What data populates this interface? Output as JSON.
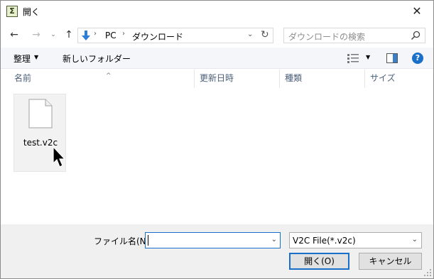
{
  "window": {
    "title": "開く",
    "app_icon": "sigma-app-icon",
    "close_label": "✕"
  },
  "nav": {
    "back_glyph": "←",
    "forward_glyph": "→",
    "recent_glyph": "⌄",
    "up_glyph": "↑",
    "address": {
      "sep1": "›",
      "pc": "PC",
      "sep2": "›",
      "folder": "ダウンロード",
      "dropdown_glyph": "⌄",
      "refresh_glyph": "↻"
    },
    "search": {
      "placeholder": "ダウンロードの検索",
      "icon": "search-icon"
    }
  },
  "toolbar": {
    "organize_label": "整理",
    "organize_caret": "▼",
    "new_folder_label": "新しいフォルダー",
    "views_caret": "▼",
    "help_label": "?"
  },
  "columns": {
    "sort_arrow": "^",
    "name": "名前",
    "date": "更新日時",
    "type": "種類",
    "size": "サイズ"
  },
  "files": [
    {
      "name": "test.v2c",
      "icon": "document-icon"
    }
  ],
  "bottom": {
    "filename_label": "ファイル名(N):",
    "filename_value": "",
    "filename_dd": "⌄",
    "filetype_value": "V2C File(*.v2c)",
    "filetype_dd": "⌄",
    "open_button": "開く(O)",
    "cancel_button": "キャンセル"
  },
  "colors": {
    "accent": "#1a6fc9",
    "toolbar_bg": "#f4f6f9",
    "bottom_bg": "#f0f0f0",
    "column_text": "#4c607a"
  }
}
